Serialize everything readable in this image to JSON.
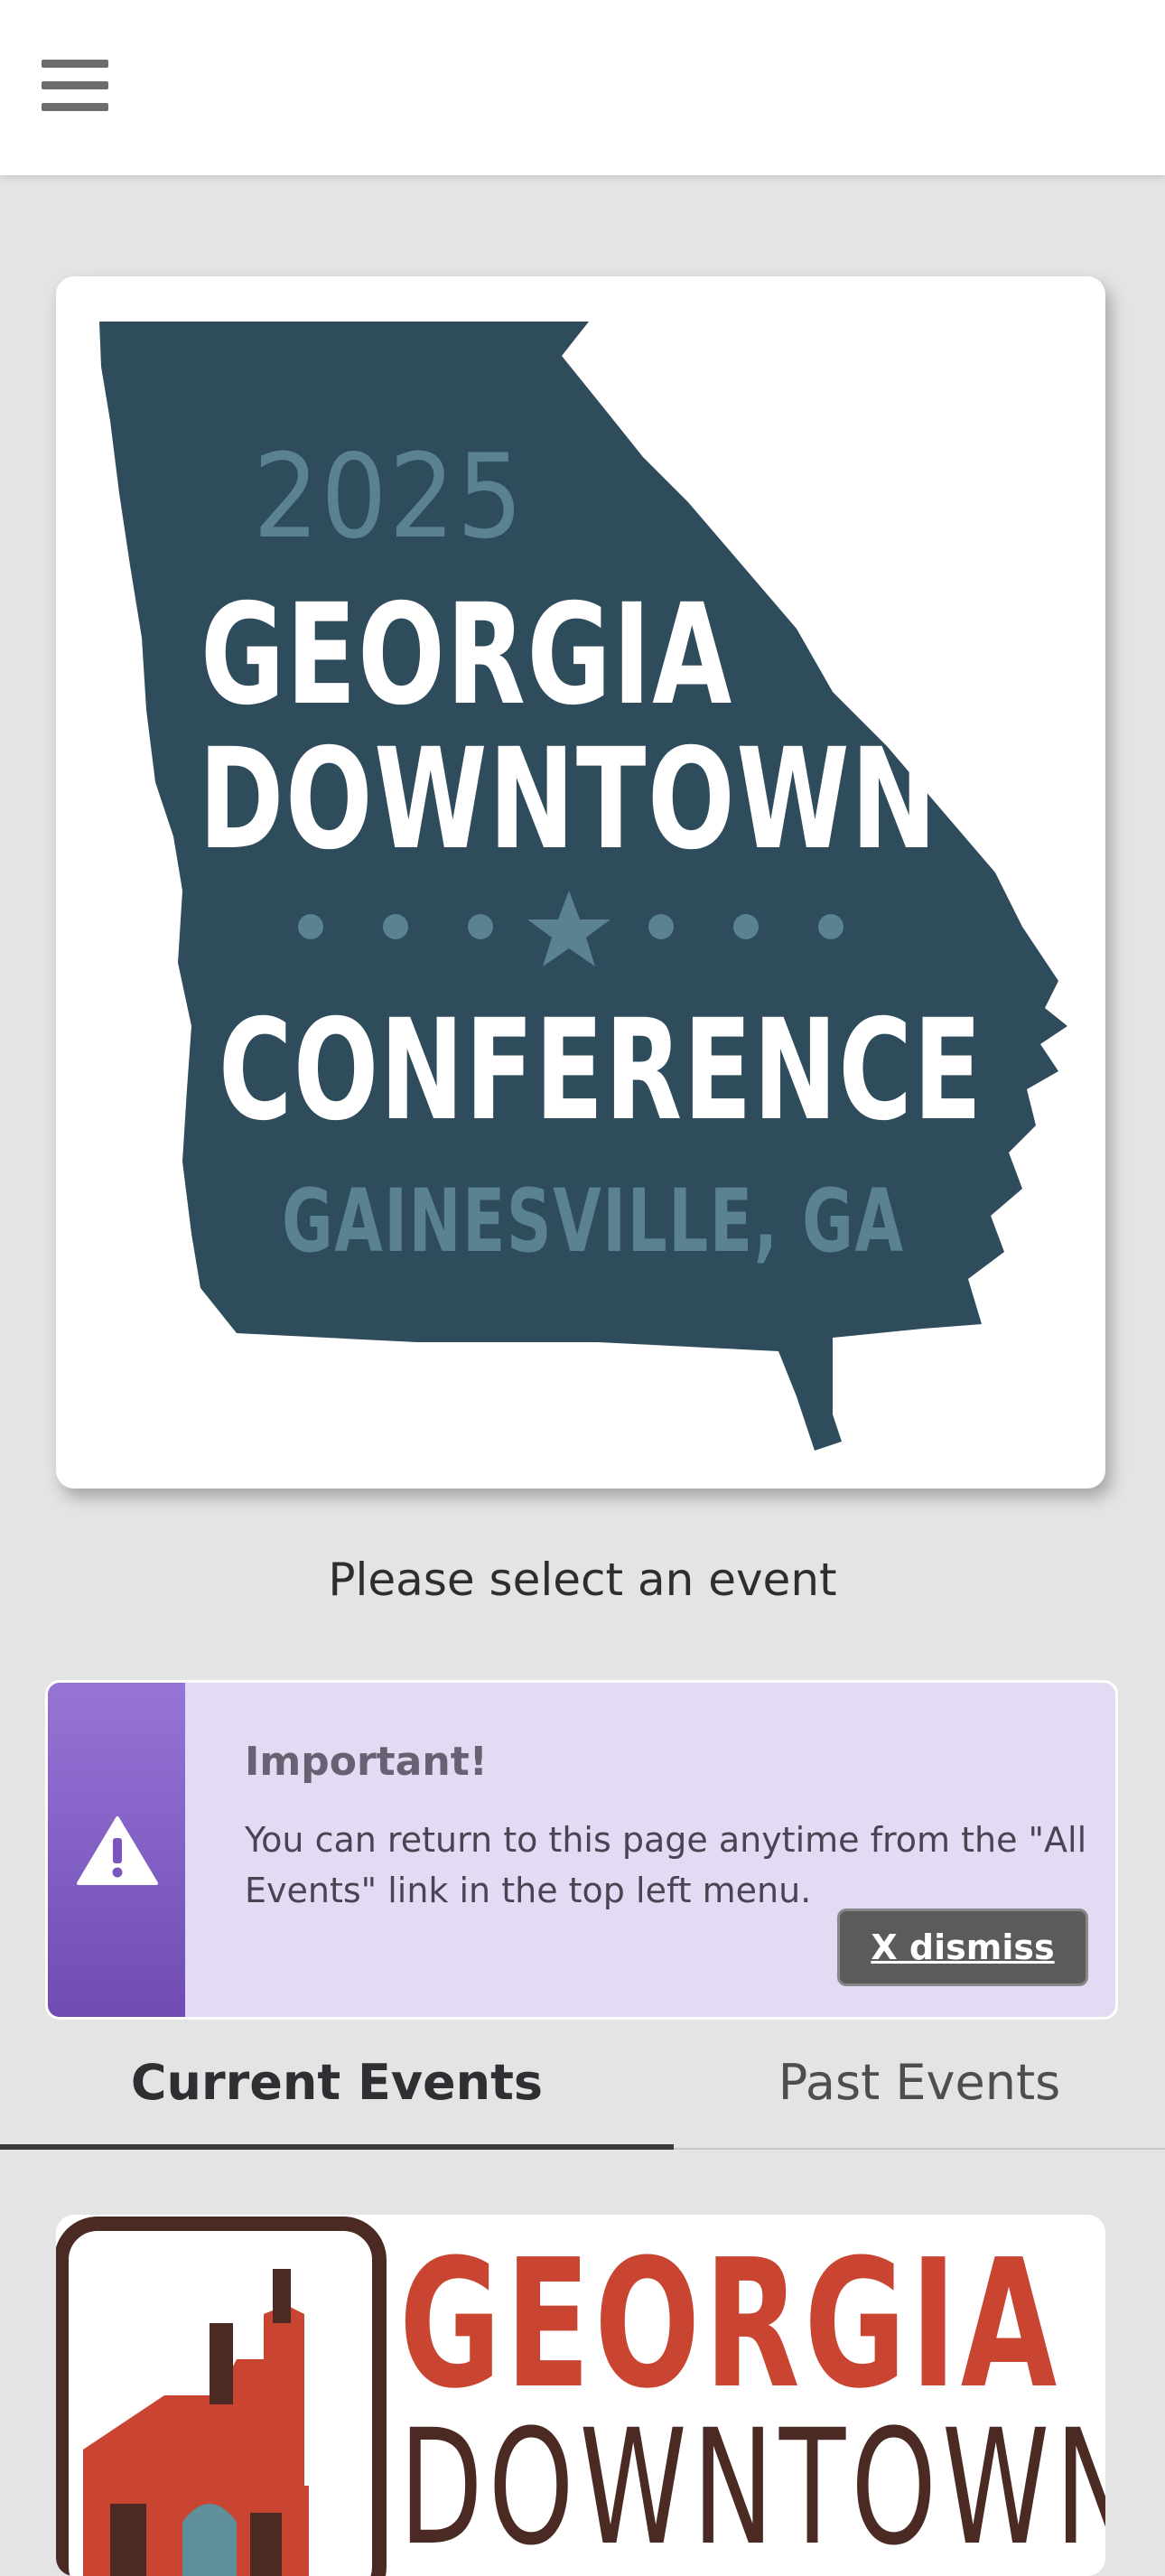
{
  "header": {
    "menu_icon": "hamburger-menu-icon"
  },
  "hero_logo": {
    "year": "2025",
    "line1": "GEORGIA",
    "line2": "DOWNTOWN",
    "line3": "CONFERENCE",
    "city": "GAINESVILLE, GA",
    "colors": {
      "map": "#2e4c5c",
      "accent": "#5a8290"
    }
  },
  "prompt": "Please select an event",
  "alert": {
    "icon": "warning-triangle-icon",
    "title": "Important!",
    "body": "You can return to this page anytime from the \"All Events\" link in the top left menu.",
    "dismiss_label": "X dismiss",
    "colors": {
      "background": "#e3daf3",
      "side": "#7a55c0"
    }
  },
  "tabs": [
    {
      "label": "Current Events",
      "active": true
    },
    {
      "label": "Past Events",
      "active": false
    }
  ],
  "events": [
    {
      "logo_line1": "GEORGIA",
      "logo_line2": "DOWNTOWN"
    }
  ]
}
